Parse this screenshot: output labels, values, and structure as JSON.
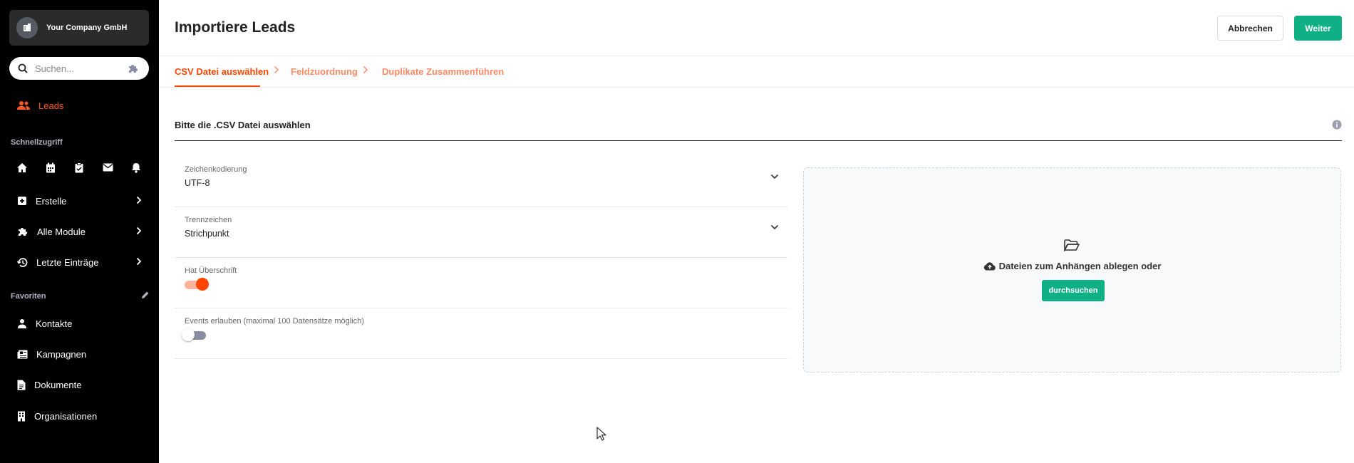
{
  "sidebar": {
    "company": "Your Company GmbH",
    "search_placeholder": "Suchen...",
    "leads": "Leads",
    "quick_access_label": "Schnellzugriff",
    "quick_icons": [
      "home-icon",
      "calendar-icon",
      "clipboard-icon",
      "mail-icon",
      "bell-icon"
    ],
    "items": [
      {
        "label": "Erstelle",
        "icon": "plus-square-icon"
      },
      {
        "label": "Alle Module",
        "icon": "puzzle-icon"
      },
      {
        "label": "Letzte Einträge",
        "icon": "history-icon"
      }
    ],
    "favorites_label": "Favoriten",
    "favorites": [
      {
        "label": "Kontakte",
        "icon": "person-icon"
      },
      {
        "label": "Kampagnen",
        "icon": "newspaper-icon"
      },
      {
        "label": "Dokumente",
        "icon": "document-icon"
      },
      {
        "label": "Organisationen",
        "icon": "building-icon"
      }
    ]
  },
  "header": {
    "title": "Importiere Leads",
    "cancel": "Abbrechen",
    "next": "Weiter"
  },
  "steps": [
    "CSV Datei auswählen",
    "Feldzuordnung",
    "Duplikate Zusammenführen"
  ],
  "section": {
    "title": "Bitte die .CSV Datei auswählen"
  },
  "form": {
    "encoding_label": "Zeichenkodierung",
    "encoding_value": "UTF-8",
    "separator_label": "Trennzeichen",
    "separator_value": "Strichpunkt",
    "header_label": "Hat Überschrift",
    "header_enabled": true,
    "events_label": "Events erlauben (maximal 100 Datensätze möglich)",
    "events_enabled": false
  },
  "dropzone": {
    "text": "Dateien zum Anhängen ablegen oder",
    "browse": "durchsuchen"
  },
  "colors": {
    "accent": "#ff4500",
    "primary": "#10b087",
    "sidebar_bg": "#000000"
  }
}
